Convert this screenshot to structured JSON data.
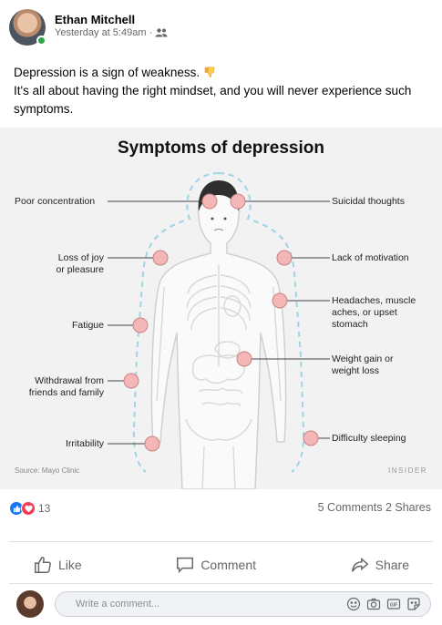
{
  "post": {
    "author": "Ethan Mitchell",
    "timestamp": "Yesterday at 5:49am",
    "separator": "·",
    "audience_icon": "friends-icon",
    "text_lines": [
      "Depression is a sign of weakness.",
      "It's all about having the right mindset, and you will never experience such",
      "symptoms."
    ],
    "emoji": "thumbs-down-emoji"
  },
  "figure": {
    "title": "Symptoms of depression",
    "left_symptoms": [
      [
        "Poor concentration"
      ],
      [
        "Loss of joy",
        "or pleasure"
      ],
      [
        "Fatigue"
      ],
      [
        "Withdrawal from",
        "friends and family"
      ],
      [
        "Irritability"
      ]
    ],
    "right_symptoms": [
      [
        "Suicidal thoughts"
      ],
      [
        "Lack of motivation"
      ],
      [
        "Headaches, muscle",
        "aches, or upset",
        "stomach"
      ],
      [
        "Weight gain or",
        "weight loss"
      ],
      [
        "Difficulty sleeping"
      ]
    ],
    "source": "Source: Mayo Clinic",
    "brand": "INSIDER",
    "marker_color": "#f4b6b6"
  },
  "engagement": {
    "reaction_count": "13",
    "comments": "5 Comments",
    "shares": "2 Shares",
    "like_color": "#1877f2",
    "love_color": "#f33e58"
  },
  "actions": {
    "like": "Like",
    "comment": "Comment",
    "share": "Share"
  },
  "comment_box": {
    "placeholder": "Write a comment..."
  }
}
